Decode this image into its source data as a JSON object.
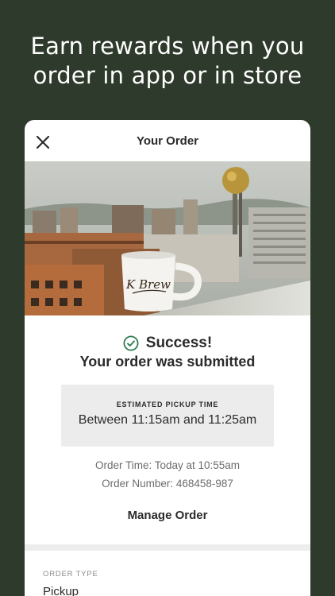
{
  "promo": {
    "line1": "Earn rewards when you",
    "line2": "order in app or in store"
  },
  "header": {
    "title": "Your Order",
    "close_icon": "close-icon"
  },
  "hero": {
    "mug_text": "K Brew",
    "icon": "photo-city-coffee-mug"
  },
  "status": {
    "icon": "check-circle-icon",
    "title": "Success!",
    "subtitle": "Your order was submitted",
    "accent_color": "#2e7d4f"
  },
  "pickup": {
    "label": "ESTIMATED PICKUP TIME",
    "window": "Between 11:15am and 11:25am"
  },
  "details": {
    "order_time": "Order Time: Today at 10:55am",
    "order_number": "Order Number: 468458-987"
  },
  "actions": {
    "manage_label": "Manage Order"
  },
  "order_type": {
    "label": "ORDER TYPE",
    "value": "Pickup"
  }
}
